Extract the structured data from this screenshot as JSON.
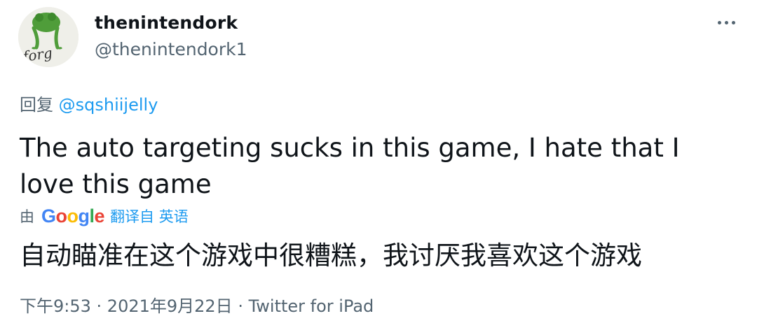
{
  "author": {
    "display_name": "thenintendork",
    "handle": "@thenintendork1",
    "avatar_text": "forg"
  },
  "reply": {
    "prefix": "回复",
    "mention": "@sqshiijelly"
  },
  "tweet": {
    "text": "The auto targeting sucks in this game, I hate that I love this game"
  },
  "translation": {
    "by_label": "由",
    "provider_logo": "Google",
    "translated_from": "翻译自 英语",
    "text": "自动瞄准在这个游戏中很糟糕，我讨厌我喜欢这个游戏"
  },
  "meta": {
    "time": "下午9:53",
    "separator1": " · ",
    "date": "2021年9月22日",
    "separator2": " · ",
    "source": "Twitter for iPad"
  },
  "icons": {
    "more": "more-dots-icon"
  },
  "colors": {
    "text_primary": "#0f1419",
    "text_secondary": "#536471",
    "link": "#1d9bf0"
  }
}
